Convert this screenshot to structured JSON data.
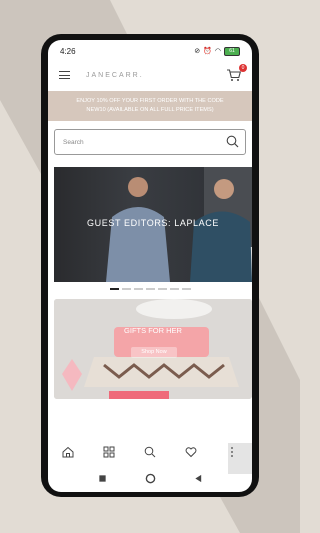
{
  "status": {
    "time": "4:26",
    "battery": "61"
  },
  "header": {
    "logo": "JANECARR.",
    "cart_count": "0"
  },
  "promo": {
    "line1": "ENJOY 10% OFF YOUR FIRST ORDER WITH THE CODE",
    "line2": "NEW10 (AVAILABLE ON ALL FULL PRICE ITEMS)"
  },
  "search": {
    "placeholder": "Search"
  },
  "hero": {
    "title": "GUEST EDITORS: LAPLACE",
    "slide_count": 7,
    "active_slide": 1
  },
  "gifts": {
    "title": "GIFTS FOR HER",
    "button": "Shop Now"
  },
  "colors": {
    "promo_bg": "#d6c7bc",
    "badge": "#dd3333",
    "accent_pink": "#f4a5a8"
  }
}
